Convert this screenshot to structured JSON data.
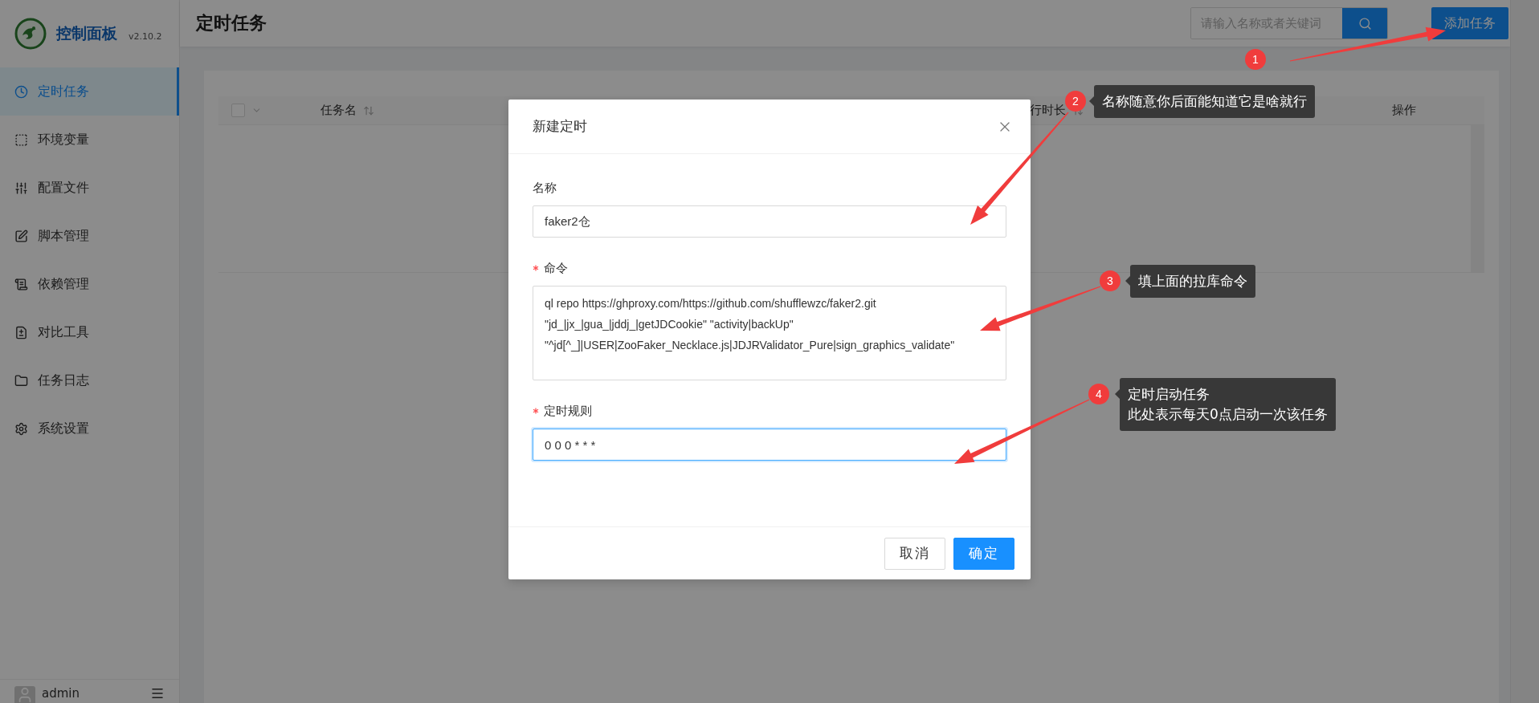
{
  "sidebar": {
    "logo_title": "控制面板",
    "version": "v2.10.2",
    "items": [
      {
        "label": "定时任务",
        "selected": true
      },
      {
        "label": "环境变量",
        "selected": false
      },
      {
        "label": "配置文件",
        "selected": false
      },
      {
        "label": "脚本管理",
        "selected": false
      },
      {
        "label": "依赖管理",
        "selected": false
      },
      {
        "label": "对比工具",
        "selected": false
      },
      {
        "label": "任务日志",
        "selected": false
      },
      {
        "label": "系统设置",
        "selected": false
      }
    ],
    "user": "admin"
  },
  "header": {
    "title": "定时任务",
    "search": {
      "placeholder": "请输入名称或者关键词"
    },
    "add_button": "添加任务"
  },
  "table": {
    "select_all": {
      "checked": false
    },
    "columns": [
      {
        "label": "任务名",
        "sortable": true
      },
      {
        "label": "行时长",
        "sortable": true
      },
      {
        "label": "操作",
        "sortable": false
      }
    ]
  },
  "dialog": {
    "title": "新建定时",
    "fields": [
      {
        "kind": "input",
        "label": "名称",
        "required": false,
        "focused": false,
        "value": "faker2仓"
      },
      {
        "kind": "textarea",
        "label": "命令",
        "required": true,
        "focused": false,
        "value": "ql repo https://ghproxy.com/https://github.com/shufflewzc/faker2.git \"jd_|jx_|gua_|jddj_|getJDCookie\" \"activity|backUp\" \"^jd[^_]|USER|ZooFaker_Necklace.js|JDJRValidator_Pure|sign_graphics_validate\""
      },
      {
        "kind": "input",
        "label": "定时规则",
        "required": true,
        "focused": true,
        "value": "0 0 0 * * *"
      }
    ],
    "buttons": [
      {
        "label": "取消",
        "primary": false
      },
      {
        "label": "确定",
        "primary": true
      }
    ]
  },
  "annotations": [
    {
      "number": "1"
    },
    {
      "number": "2",
      "lines": [
        "名称随意你后面能知道它是啥就行"
      ]
    },
    {
      "number": "3",
      "lines": [
        "填上面的拉库命令"
      ]
    },
    {
      "number": "4",
      "lines": [
        "定时启动任务",
        "此处表示每天0点启动一次该任务"
      ]
    }
  ]
}
